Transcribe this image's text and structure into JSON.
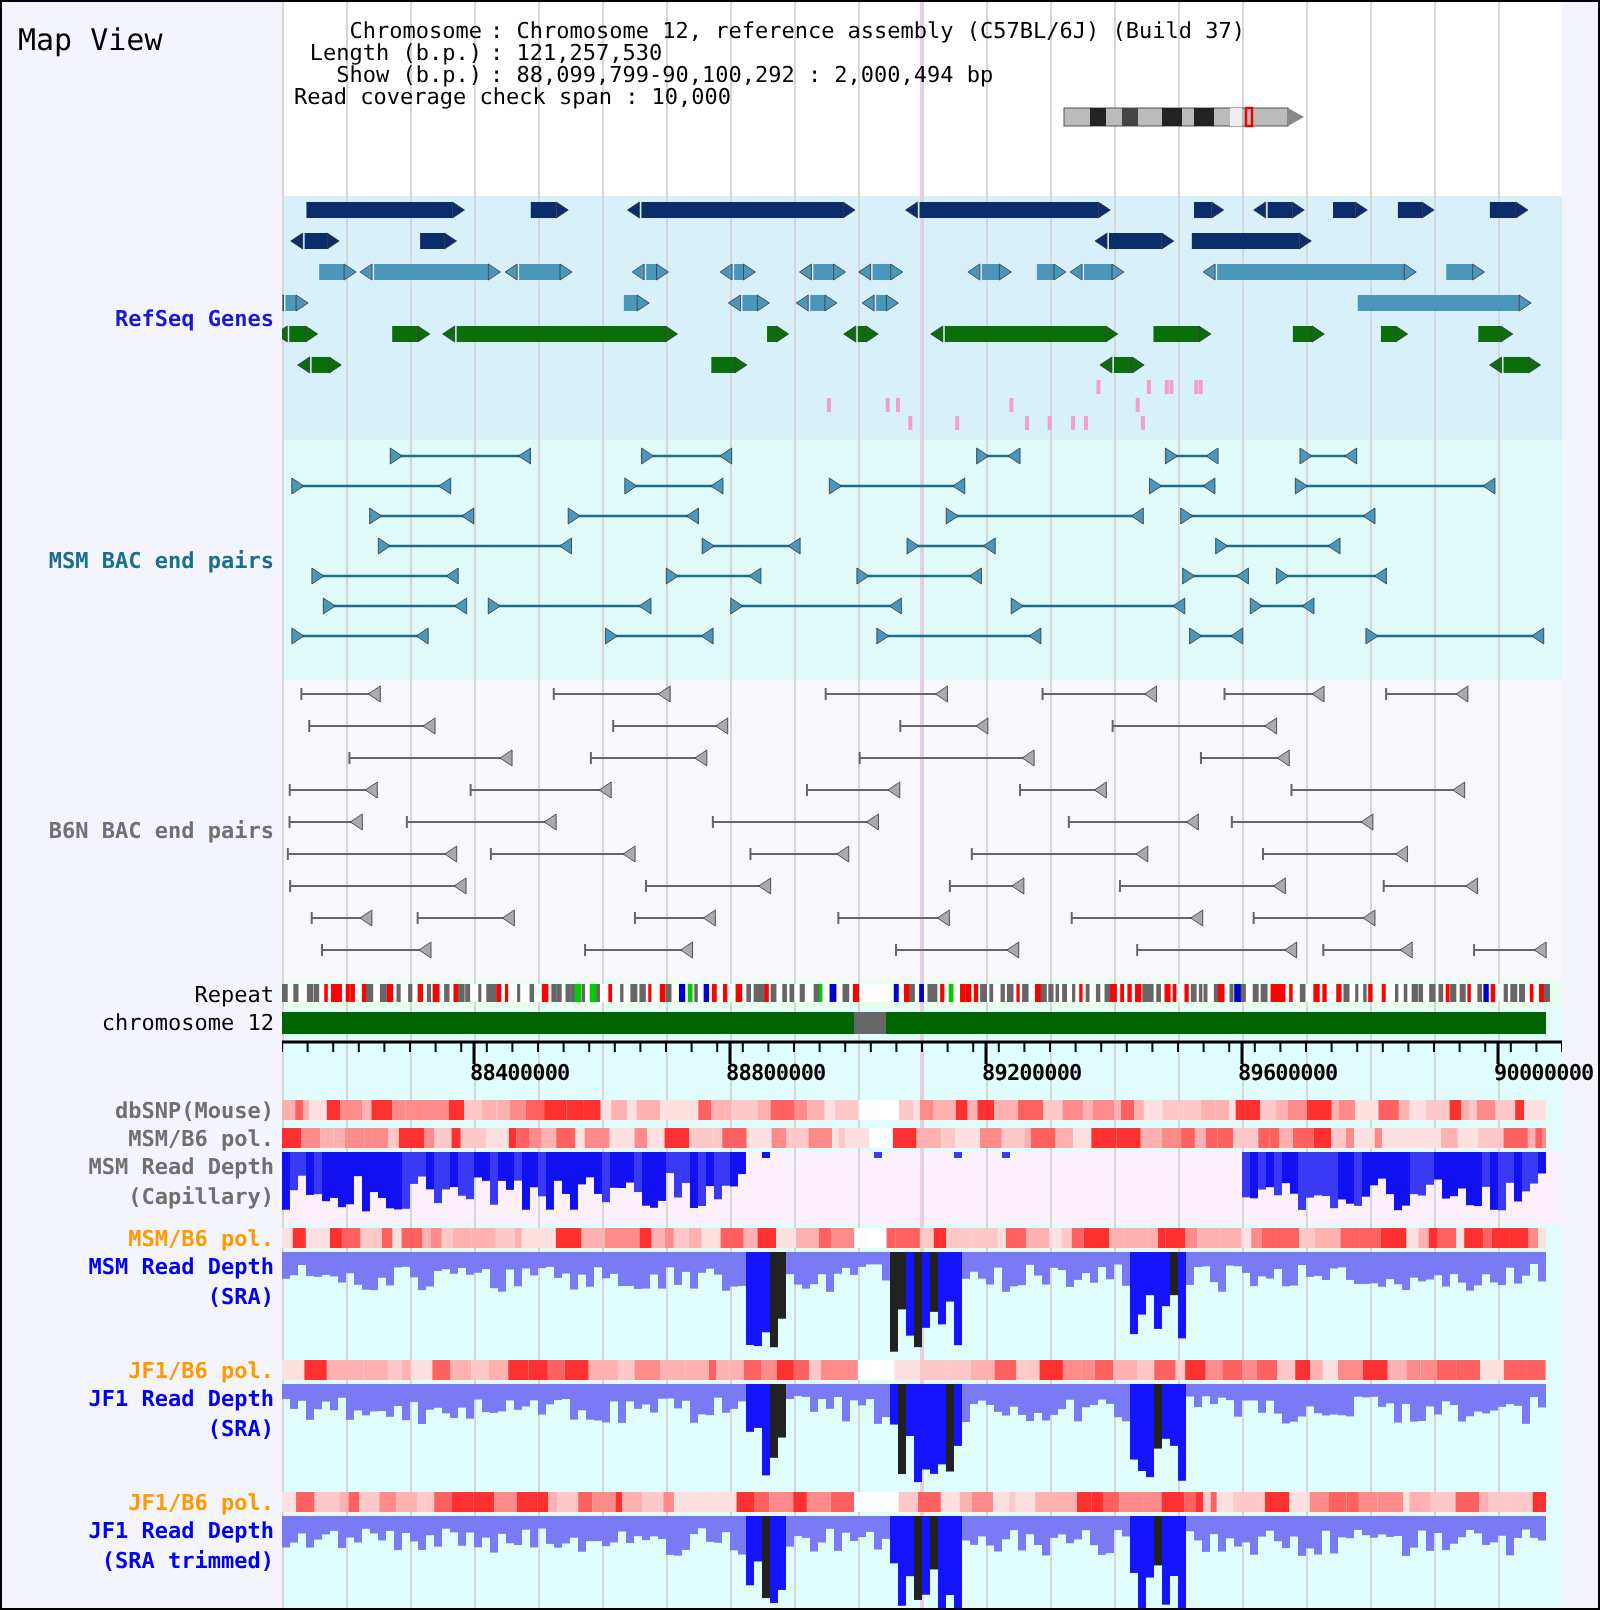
{
  "title": "Map View",
  "info": [
    {
      "label": "Chromosome",
      "value": ": Chromosome 12, reference assembly (C57BL/6J) (Build 37)"
    },
    {
      "label": "Length (b.p.)",
      "value": ": 121,257,530"
    },
    {
      "label": "Show (b.p.)",
      "value": ": 88,099,799-90,100,292 : 2,000,494 bp"
    }
  ],
  "span_note": "Read coverage check span : 10,000",
  "tracks": [
    {
      "kind": "genes",
      "label": [
        "RefSeq Genes"
      ],
      "color": "#1a1ad0"
    },
    {
      "kind": "bac",
      "label": [
        "MSM BAC end pairs"
      ],
      "color": "#1a6f8f"
    },
    {
      "kind": "bac2",
      "label": [
        "B6N BAC end pairs"
      ],
      "color": "#707070"
    },
    {
      "kind": "repeat",
      "label": [
        "Repeat"
      ],
      "color": "#000000"
    },
    {
      "kind": "chromosome",
      "label": [
        "chromosome 12"
      ],
      "color": "#000000"
    },
    {
      "kind": "axis",
      "ticks": [
        "88400000",
        "88800000",
        "89200000",
        "89600000",
        "90000000"
      ]
    },
    {
      "kind": "heat",
      "label": [
        "dbSNP(Mouse)"
      ],
      "color": "#707070"
    },
    {
      "kind": "heat",
      "label": [
        "MSM/B6 pol."
      ],
      "color": "#707070"
    },
    {
      "kind": "coverage",
      "label": [
        "MSM Read Depth",
        "(Capillary)"
      ],
      "color": "#707070"
    },
    {
      "kind": "heat",
      "label": [
        "MSM/B6 pol."
      ],
      "color": "#ff9900"
    },
    {
      "kind": "depth",
      "label": [
        "MSM Read Depth",
        "(SRA)"
      ],
      "color": "#0000ee"
    },
    {
      "kind": "heat",
      "label": [
        "JF1/B6 pol."
      ],
      "color": "#ff9900"
    },
    {
      "kind": "depth",
      "label": [
        "JF1 Read Depth",
        "(SRA)"
      ],
      "color": "#0000ee"
    },
    {
      "kind": "heat",
      "label": [
        "JF1/B6 pol."
      ],
      "color": "#ff9900"
    },
    {
      "kind": "depth",
      "label": [
        "JF1 Read Depth",
        "(SRA trimmed)"
      ],
      "color": "#0000ee"
    }
  ]
}
